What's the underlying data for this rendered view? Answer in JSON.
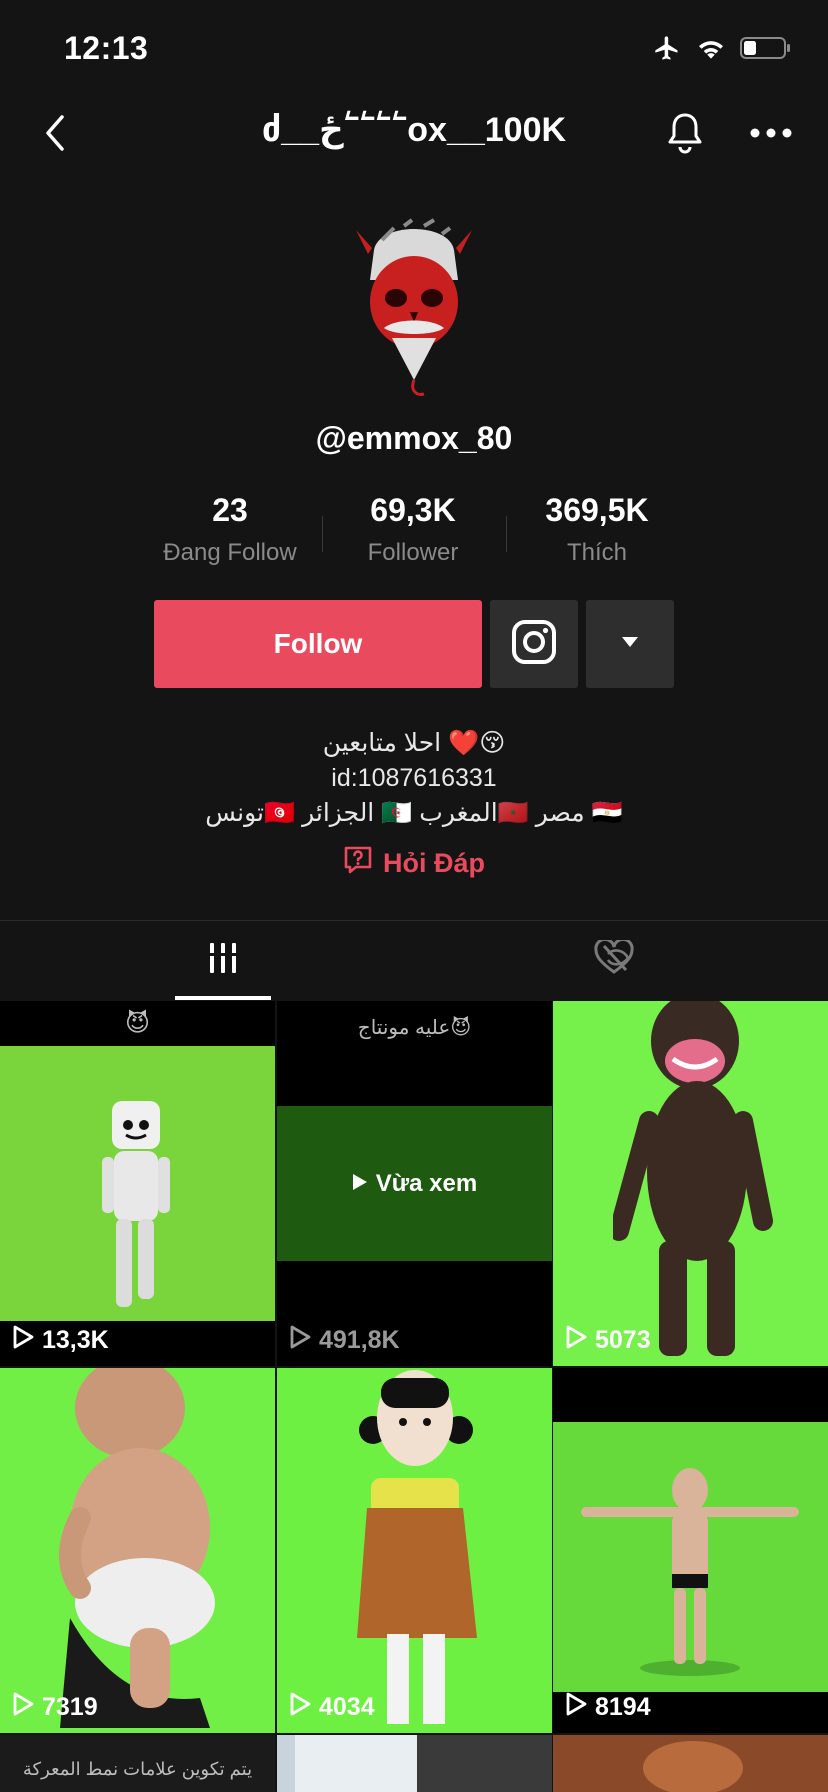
{
  "status": {
    "time": "12:13"
  },
  "nav": {
    "title": "ძ__ځ՟՟՟՟ox__100K"
  },
  "profile": {
    "username": "@emmox_80",
    "stats": [
      {
        "value": "23",
        "label": "Đang Follow"
      },
      {
        "value": "69,3K",
        "label": "Follower"
      },
      {
        "value": "369,5K",
        "label": "Thích"
      }
    ],
    "follow_label": "Follow",
    "bio": [
      "احلا متابعين ❤️😚",
      "id:1087616331",
      "تونس🇹🇳 الجزائر 🇩🇿 المغرب🇲🇦 مصر 🇪🇬"
    ],
    "qa_label": "Hỏi Đáp"
  },
  "videos": [
    {
      "views": "13,3K",
      "bg": "#7ad53c",
      "top_text": "😈"
    },
    {
      "views": "491,8K",
      "bg": "#000000",
      "overlay": "Vừa xem",
      "top_text": "عليه مونتاج😈"
    },
    {
      "views": "5073",
      "bg": "#76f04a"
    },
    {
      "views": "7319",
      "bg": "#72ef46"
    },
    {
      "views": "4034",
      "bg": "#6ef043"
    },
    {
      "views": "8194",
      "bg": "#66d93b"
    }
  ],
  "bottom_text": "يتم تكوين علامات نمط المعركة",
  "colors": {
    "accent": "#ea4a5e",
    "background": "#141414"
  }
}
